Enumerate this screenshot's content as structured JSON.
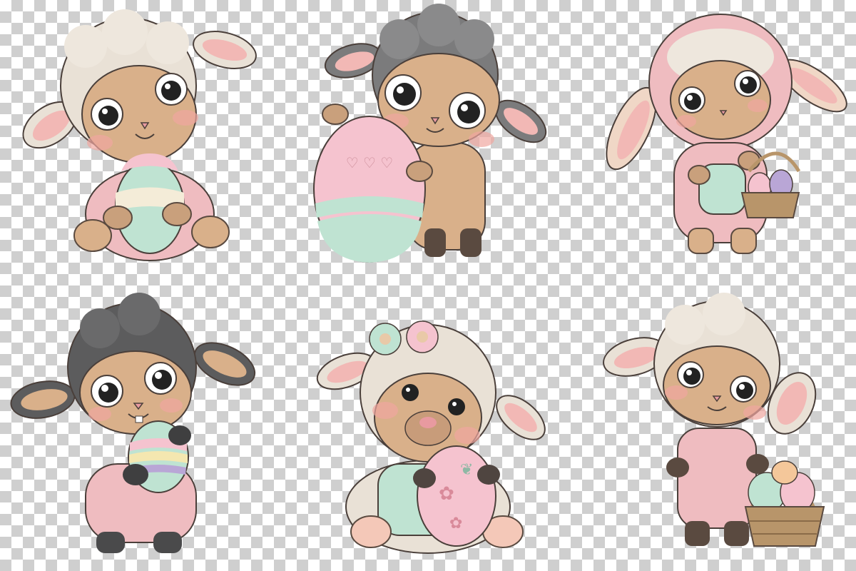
{
  "background": {
    "checker_light": "#ffffff",
    "checker_dark": "#cfcfcf"
  },
  "palette": {
    "wool_cream": "#e9e1d6",
    "wool_grey": "#6f6f70",
    "skin": "#d9b08a",
    "cheek": "#f0a6a0",
    "pink_outfit": "#efbcc0",
    "mint": "#bfe3d2",
    "egg_pink": "#f5c3cf",
    "egg_yellow": "#f4e7b0",
    "egg_purple": "#b9a6d6",
    "basket": "#b8956a",
    "hoof": "#5a4a40",
    "outline": "#4a3f3a"
  },
  "lambs": [
    {
      "pose": "sitting-hugging-egg",
      "wool": "cream",
      "outfit": "pink-pajamas",
      "egg": "pink-cream-mint-striped"
    },
    {
      "pose": "standing-behind-large-egg",
      "wool": "grey",
      "outfit": "none",
      "egg": "pink-mint-heart-pattern"
    },
    {
      "pose": "standing-bunny-hood",
      "wool": "cream",
      "outfit": "pink-bunny-onesie",
      "egg": "basket-of-eggs"
    },
    {
      "pose": "standing-holding-egg",
      "wool": "dark-grey",
      "outfit": "pink-jumpsuit",
      "egg": "rainbow-striped"
    },
    {
      "pose": "sitting-flower-crown",
      "wool": "cream",
      "outfit": "mint-overalls",
      "egg": "pink-flower-butterfly"
    },
    {
      "pose": "standing-with-basket",
      "wool": "cream",
      "outfit": "pink-overalls",
      "egg": "basket-of-eggs"
    }
  ]
}
